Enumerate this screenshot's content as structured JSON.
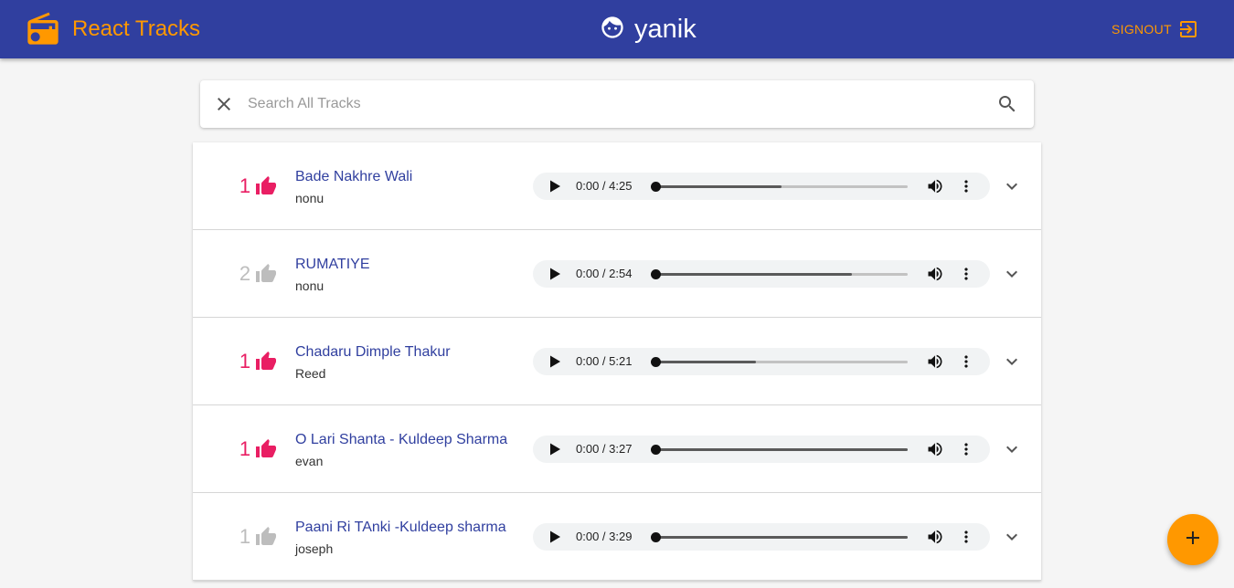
{
  "header": {
    "app_title": "React Tracks",
    "app_icon": "radio-icon",
    "username": "yanik",
    "user_icon": "face-icon",
    "signout_label": "SIGNOUT",
    "signout_icon": "exit-icon"
  },
  "search": {
    "placeholder": "Search All Tracks",
    "value": "",
    "clear_icon": "close-icon",
    "search_icon": "search-icon"
  },
  "tracks": [
    {
      "likes": "1",
      "liked": true,
      "title": "Bade Nakhre Wali",
      "artist": "nonu",
      "time": "0:00 / 4:25",
      "buffered": 0.5
    },
    {
      "likes": "2",
      "liked": false,
      "title": "RUMATIYE",
      "artist": "nonu",
      "time": "0:00 / 2:54",
      "buffered": 0.78
    },
    {
      "likes": "1",
      "liked": true,
      "title": "Chadaru Dimple Thakur",
      "artist": "Reed",
      "time": "0:00 / 5:21",
      "buffered": 0.4
    },
    {
      "likes": "1",
      "liked": true,
      "title": "O Lari Shanta - Kuldeep Sharma",
      "artist": "evan",
      "time": "0:00 / 3:27",
      "buffered": 1.0
    },
    {
      "likes": "1",
      "liked": false,
      "title": "Paani Ri TAnki -Kuldeep sharma",
      "artist": "joseph",
      "time": "0:00 / 3:29",
      "buffered": 1.0
    }
  ],
  "fab_icon": "add-icon",
  "colors": {
    "appbar": "#303f9f",
    "accent": "#ff9800",
    "liked": "#e91e63",
    "unliked": "#bdbdbd",
    "title_link": "#303f9f"
  }
}
